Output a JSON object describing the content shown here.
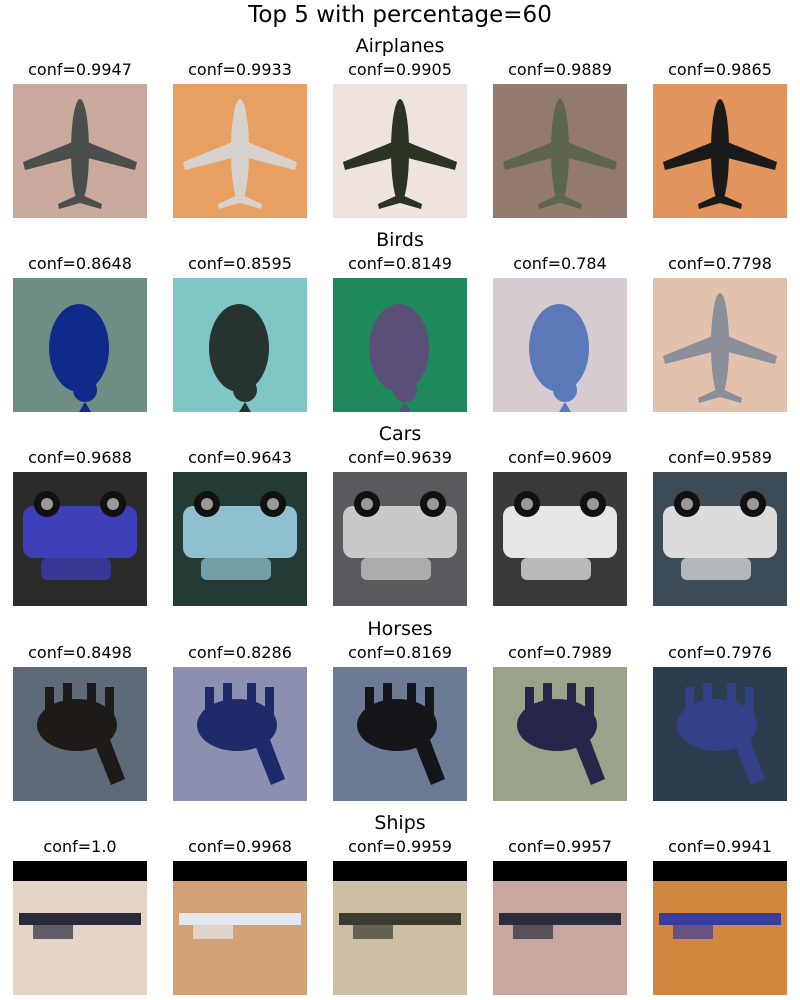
{
  "title": "Top 5 with percentage=60",
  "rows": [
    {
      "label": "Airplanes",
      "items": [
        {
          "conf": "conf=0.9947",
          "icon": "airplane-image",
          "bg": "#c8a99b",
          "fg": "#4a4f4c",
          "shape": "plane"
        },
        {
          "conf": "conf=0.9933",
          "icon": "airplane-image",
          "bg": "#e7a062",
          "fg": "#d7d3cc",
          "shape": "plane"
        },
        {
          "conf": "conf=0.9905",
          "icon": "airplane-image",
          "bg": "#efe3e0",
          "fg": "#2b3424",
          "shape": "plane"
        },
        {
          "conf": "conf=0.9889",
          "icon": "airplane-image",
          "bg": "#927b6e",
          "fg": "#5e6650",
          "shape": "plane"
        },
        {
          "conf": "conf=0.9865",
          "icon": "airplane-image",
          "bg": "#e1955c",
          "fg": "#1a1a1a",
          "shape": "plane"
        }
      ]
    },
    {
      "label": "Birds",
      "items": [
        {
          "conf": "conf=0.8648",
          "icon": "bird-image",
          "bg": "#6e8d84",
          "fg": "#102a8a",
          "shape": "bird"
        },
        {
          "conf": "conf=0.8595",
          "icon": "bird-image",
          "bg": "#7fc6c7",
          "fg": "#26332e",
          "shape": "bird"
        },
        {
          "conf": "conf=0.8149",
          "icon": "bird-image",
          "bg": "#1e8a5c",
          "fg": "#5a4f78",
          "shape": "bird"
        },
        {
          "conf": "conf=0.784",
          "icon": "bird-image",
          "bg": "#d6cbd0",
          "fg": "#5b79b8",
          "shape": "bird"
        },
        {
          "conf": "conf=0.7798",
          "icon": "bird-image",
          "bg": "#e2c2ad",
          "fg": "#8a8f9a",
          "shape": "plane"
        }
      ]
    },
    {
      "label": "Cars",
      "items": [
        {
          "conf": "conf=0.9688",
          "icon": "car-image",
          "bg": "#2b2b2b",
          "fg": "#3e3eb8",
          "shape": "car"
        },
        {
          "conf": "conf=0.9643",
          "icon": "car-image",
          "bg": "#243a34",
          "fg": "#8fc0cf",
          "shape": "car"
        },
        {
          "conf": "conf=0.9639",
          "icon": "car-image",
          "bg": "#5a5a5e",
          "fg": "#c9c9c9",
          "shape": "car"
        },
        {
          "conf": "conf=0.9609",
          "icon": "car-image",
          "bg": "#3a3a3a",
          "fg": "#e6e6e6",
          "shape": "car"
        },
        {
          "conf": "conf=0.9589",
          "icon": "car-image",
          "bg": "#3c4b55",
          "fg": "#dcdcdc",
          "shape": "car"
        }
      ]
    },
    {
      "label": "Horses",
      "items": [
        {
          "conf": "conf=0.8498",
          "icon": "horse-image",
          "bg": "#5f6a78",
          "fg": "#1d1a18",
          "shape": "horse"
        },
        {
          "conf": "conf=0.8286",
          "icon": "horse-image",
          "bg": "#8c8fb0",
          "fg": "#1f2a6a",
          "shape": "horse"
        },
        {
          "conf": "conf=0.8169",
          "icon": "horse-image",
          "bg": "#6c7a95",
          "fg": "#15161a",
          "shape": "horse"
        },
        {
          "conf": "conf=0.7989",
          "icon": "horse-image",
          "bg": "#9aa389",
          "fg": "#26264a",
          "shape": "horse"
        },
        {
          "conf": "conf=0.7976",
          "icon": "horse-image",
          "bg": "#2c3d50",
          "fg": "#33408a",
          "shape": "horse"
        }
      ]
    },
    {
      "label": "Ships",
      "items": [
        {
          "conf": "conf=1.0",
          "icon": "ship-image",
          "bg": "#e3d6c6",
          "fg": "#2a2a3a",
          "shape": "ship"
        },
        {
          "conf": "conf=0.9968",
          "icon": "ship-image",
          "bg": "#d2a276",
          "fg": "#e4e8ee",
          "shape": "ship"
        },
        {
          "conf": "conf=0.9959",
          "icon": "ship-image",
          "bg": "#cdbfa4",
          "fg": "#3a3a2e",
          "shape": "ship"
        },
        {
          "conf": "conf=0.9957",
          "icon": "ship-image",
          "bg": "#c9a7a0",
          "fg": "#2a2d3c",
          "shape": "ship"
        },
        {
          "conf": "conf=0.9941",
          "icon": "ship-image",
          "bg": "#d0883e",
          "fg": "#3a3da0",
          "shape": "ship"
        }
      ]
    }
  ]
}
